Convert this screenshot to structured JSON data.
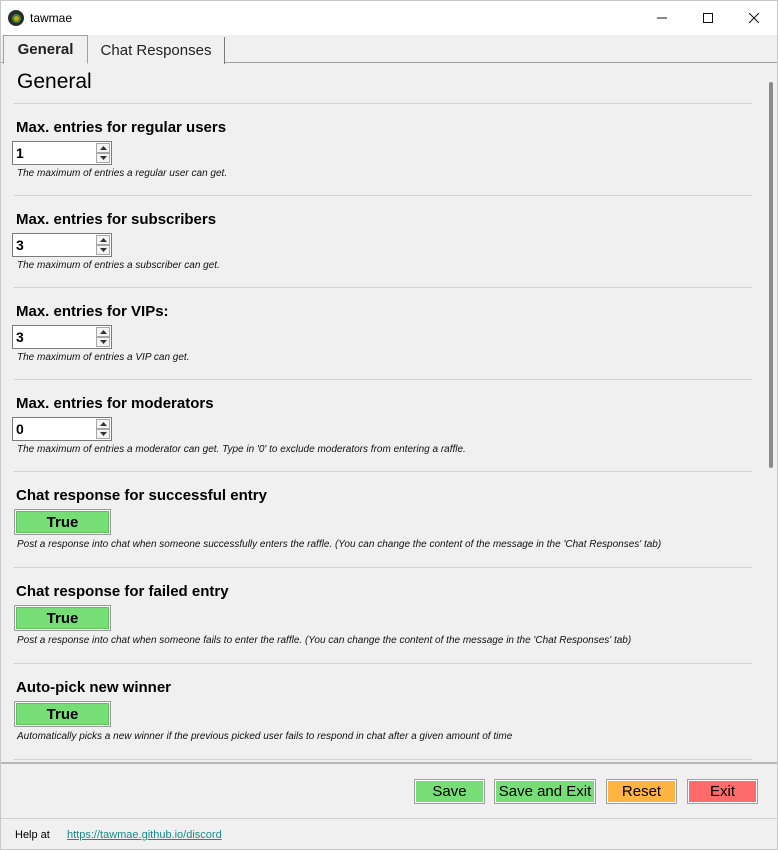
{
  "window": {
    "title": "tawmae",
    "icon": "app-logo-icon"
  },
  "tabs": [
    {
      "label": "General",
      "active": true
    },
    {
      "label": "Chat Responses",
      "active": false
    }
  ],
  "page_title": "General",
  "sections": {
    "regular": {
      "label": "Max. entries for regular users",
      "value": "1",
      "description": "The maximum of entries a regular user can get."
    },
    "subscribers": {
      "label": "Max. entries for subscribers",
      "value": "3",
      "description": "The maximum of entries a subscriber can get."
    },
    "vips": {
      "label": "Max. entries for VIPs:",
      "value": "3",
      "description": "The maximum of entries a VIP can get."
    },
    "moderators": {
      "label": "Max. entries for moderators",
      "value": "0",
      "description": "The maximum of entries a moderator can get. Type in '0' to exclude moderators from entering a raffle."
    },
    "success_response": {
      "label": "Chat response for successful entry",
      "value": "True",
      "description": "Post a response into chat when someone successfully enters the raffle. (You can change the content of the message in the 'Chat Responses' tab)"
    },
    "failed_response": {
      "label": "Chat response for failed entry",
      "value": "True",
      "description": "Post a response into chat when someone fails to enter the raffle. (You can change the content of the message in the 'Chat Responses' tab)"
    },
    "autopick": {
      "label": "Auto-pick new winner",
      "value": "True",
      "description": "Automatically picks a new winner if the previous picked user fails to respond in chat after a given amount of time"
    }
  },
  "buttons": {
    "save": "Save",
    "save_exit": "Save and Exit",
    "reset": "Reset",
    "exit": "Exit"
  },
  "footer": {
    "help_label": "Help at",
    "help_link": "https://tawmae.github.io/discord"
  },
  "colors": {
    "true_toggle": "#77de77",
    "save": "#77de77",
    "reset": "#ffb340",
    "exit": "#ff6a6a",
    "link": "#1b8a8a"
  }
}
